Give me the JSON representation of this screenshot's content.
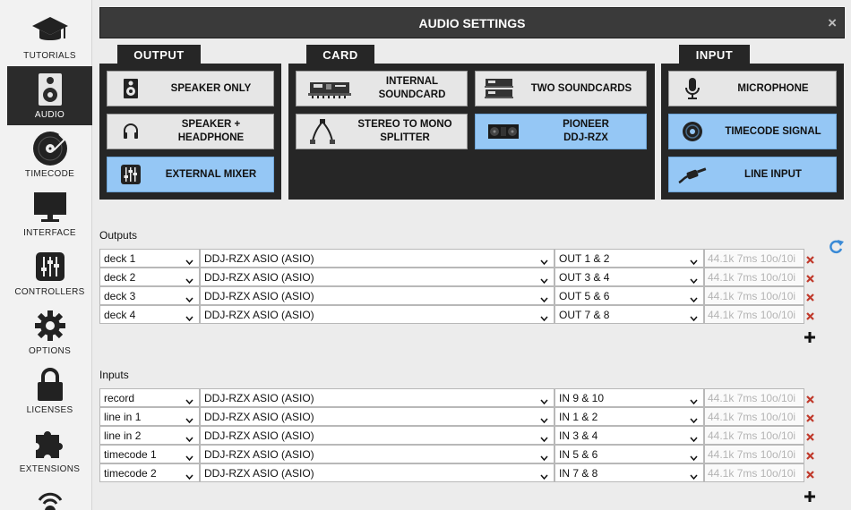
{
  "sidebar": {
    "items": [
      {
        "label": "TUTORIALS",
        "icon": "graduation-cap-icon"
      },
      {
        "label": "AUDIO",
        "icon": "speaker-icon",
        "active": true
      },
      {
        "label": "TIMECODE",
        "icon": "vinyl-record-icon"
      },
      {
        "label": "INTERFACE",
        "icon": "monitor-icon"
      },
      {
        "label": "CONTROLLERS",
        "icon": "mixer-sliders-icon"
      },
      {
        "label": "OPTIONS",
        "icon": "gear-icon"
      },
      {
        "label": "LICENSES",
        "icon": "lock-icon"
      },
      {
        "label": "EXTENSIONS",
        "icon": "puzzle-icon"
      }
    ]
  },
  "window": {
    "title": "AUDIO SETTINGS",
    "close": "×"
  },
  "output": {
    "tab": "OUTPUT",
    "buttons": [
      {
        "label": "SPEAKER ONLY",
        "icon": "speaker-icon",
        "selected": false
      },
      {
        "label": "SPEAKER +\nHEADPHONE",
        "icon": "headphone-icon",
        "selected": false
      },
      {
        "label": "EXTERNAL MIXER",
        "icon": "mixer-icon",
        "selected": true
      }
    ]
  },
  "card": {
    "tab": "CARD",
    "buttons": [
      {
        "label": "INTERNAL\nSOUNDCARD",
        "icon": "internal-soundcard-icon",
        "selected": false
      },
      {
        "label": "TWO SOUNDCARDS",
        "icon": "two-soundcards-icon",
        "selected": false
      },
      {
        "label": "STEREO TO MONO\nSPLITTER",
        "icon": "splitter-cable-icon",
        "selected": false
      },
      {
        "label": "PIONEER\nDDJ-RZX",
        "icon": "pioneer-controller-icon",
        "selected": true
      }
    ]
  },
  "input": {
    "tab": "INPUT",
    "buttons": [
      {
        "label": "MICROPHONE",
        "icon": "microphone-icon",
        "selected": false
      },
      {
        "label": "TIMECODE SIGNAL",
        "icon": "timecode-disc-icon",
        "selected": true
      },
      {
        "label": "LINE INPUT",
        "icon": "jack-plug-icon",
        "selected": true
      }
    ]
  },
  "outputs": {
    "label": "Outputs",
    "rows": [
      {
        "name": "deck 1",
        "device": "DDJ-RZX ASIO (ASIO)",
        "channels": "OUT 1 & 2",
        "info": "44.1k 7ms 10o/10i"
      },
      {
        "name": "deck 2",
        "device": "DDJ-RZX ASIO (ASIO)",
        "channels": "OUT 3 & 4",
        "info": "44.1k 7ms 10o/10i"
      },
      {
        "name": "deck 3",
        "device": "DDJ-RZX ASIO (ASIO)",
        "channels": "OUT 5 & 6",
        "info": "44.1k 7ms 10o/10i"
      },
      {
        "name": "deck 4",
        "device": "DDJ-RZX ASIO (ASIO)",
        "channels": "OUT 7 & 8",
        "info": "44.1k 7ms 10o/10i"
      }
    ]
  },
  "inputs": {
    "label": "Inputs",
    "rows": [
      {
        "name": "record",
        "device": "DDJ-RZX ASIO (ASIO)",
        "channels": "IN 9 & 10",
        "info": "44.1k 7ms 10o/10i"
      },
      {
        "name": "line in 1",
        "device": "DDJ-RZX ASIO (ASIO)",
        "channels": "IN 1 & 2",
        "info": "44.1k 7ms 10o/10i"
      },
      {
        "name": "line in 2",
        "device": "DDJ-RZX ASIO (ASIO)",
        "channels": "IN 3 & 4",
        "info": "44.1k 7ms 10o/10i"
      },
      {
        "name": "timecode 1",
        "device": "DDJ-RZX ASIO (ASIO)",
        "channels": "IN 5 & 6",
        "info": "44.1k 7ms 10o/10i"
      },
      {
        "name": "timecode 2",
        "device": "DDJ-RZX ASIO (ASIO)",
        "channels": "IN 7 & 8",
        "info": "44.1k 7ms 10o/10i"
      }
    ]
  },
  "colors": {
    "selected": "#95c7f5",
    "panel": "#262626",
    "delete": "#c0392b"
  }
}
